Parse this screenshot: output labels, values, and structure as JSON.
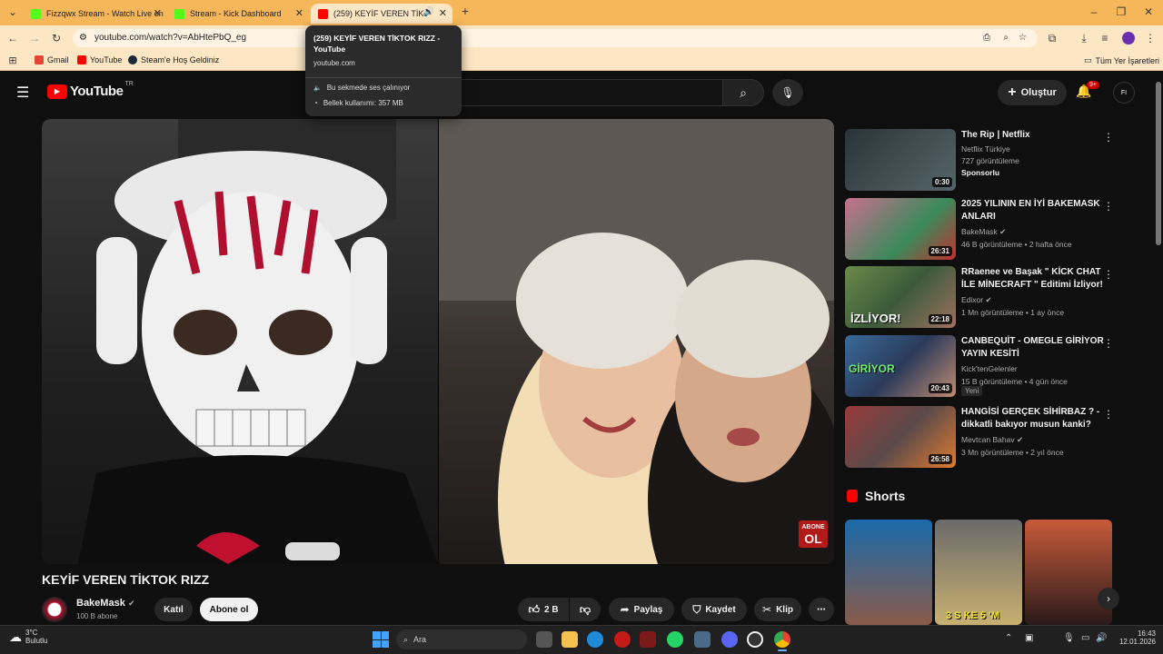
{
  "browser": {
    "tabs": [
      {
        "label": "Fizzqwx Stream - Watch Live on",
        "color": "#53fc18"
      },
      {
        "label": "Stream - Kick Dashboard",
        "color": "#53fc18"
      },
      {
        "label": "(259) KEYİF VEREN TİKTOK RIZZ",
        "color": "#ff0000"
      }
    ],
    "new_tab": "+",
    "url": "youtube.com/watch?v=AbHtePbQ_eg",
    "bookmarks": [
      {
        "label": "Gmail",
        "color": "#ea4335"
      },
      {
        "label": "YouTube",
        "color": "#ff0000"
      },
      {
        "label": "Steam'e Hoş Geldiniz",
        "color": "#1b2838"
      }
    ],
    "all_bookmarks": "Tüm Yer İşaretleri"
  },
  "tooltip": {
    "title": "(259) KEYİF VEREN TİKTOK RIZZ - YouTube",
    "domain": "youtube.com",
    "audio": "Bu sekmede ses çalınıyor",
    "memory": "Bellek kullanımı: 357 MB"
  },
  "youtube": {
    "logo_text": "YouTube",
    "region": "TR",
    "create_label": "Oluştur",
    "notif_count": "9+",
    "avatar_initials": "FI",
    "video": {
      "title": "KEYİF VEREN TİKTOK RIZZ",
      "overlay_badge_top": "ABONE",
      "overlay_badge_bottom": "OL"
    },
    "channel": {
      "name": "BakeMask",
      "subs": "100 B abone",
      "join": "Katıl",
      "subscribe": "Abone ol"
    },
    "actions": {
      "likes": "2 B",
      "share": "Paylaş",
      "save": "Kaydet",
      "clip": "Klip",
      "more": "⋯"
    },
    "recommendations": [
      {
        "title": "The Rip | Netflix",
        "channel": "Netflix Türkiye",
        "line2": "727 görüntüleme",
        "line3": "Sponsorlu",
        "duration": "0:30",
        "thumb": "#3d4a4f"
      },
      {
        "title": "2025 YILININ EN İYİ BAKEMASK ANLARI",
        "channel": "BakeMask",
        "line2": "46 B görüntüleme • 2 hafta önce",
        "duration": "26:31",
        "thumb": "#8a5a6a"
      },
      {
        "title": "RRaenee ve Başak \" KİCK CHAT İLE MİNECRAFT \" Editimi İzliyor!",
        "channel": "Edixor",
        "line2": "1 Mn görüntüleme • 1 ay önce",
        "duration": "22:18",
        "thumb": "#4f6a3a",
        "thumb_text": "İZLİYOR!"
      },
      {
        "title": "CANBEQUİT - OMEGLE GİRİYOR YAYIN KESİTİ",
        "channel": "Kick'tenGelenler",
        "line2": "15 B görüntüleme • 4 gün önce",
        "badge": "Yeni",
        "duration": "20:43",
        "thumb": "#3b5a7a",
        "thumb_text": "GİRİYOR"
      },
      {
        "title": "HANGİSİ GERÇEK SİHİRBAZ ? - dikkatli bakıyor musun kanki?",
        "channel": "Mevtcan Bahav",
        "line2": "3 Mn görüntüleme • 2 yıl önce",
        "duration": "26:58",
        "thumb": "#7a3a3a"
      }
    ],
    "shorts_label": "Shorts",
    "shorts_caption": "3 S KE 5 'M"
  },
  "taskbar": {
    "weather_temp": "3°C",
    "weather_desc": "Bulutlu",
    "search_placeholder": "Ara",
    "time": "16:43",
    "date": "12.01.2026"
  }
}
